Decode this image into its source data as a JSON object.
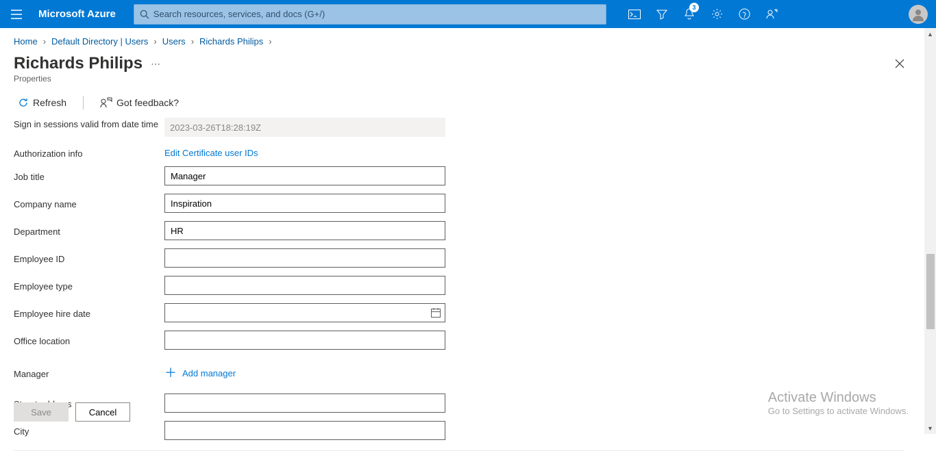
{
  "header": {
    "brand": "Microsoft Azure",
    "search_placeholder": "Search resources, services, and docs (G+/)",
    "notification_count": "3"
  },
  "breadcrumb": {
    "items": [
      "Home",
      "Default Directory | Users",
      "Users",
      "Richards Philips"
    ]
  },
  "page": {
    "title": "Richards Philips",
    "subtitle": "Properties"
  },
  "toolbar": {
    "refresh_label": "Refresh",
    "feedback_label": "Got feedback?"
  },
  "form": {
    "signin_label": "Sign in sessions valid from date time",
    "signin_value": "2023-03-26T18:28:19Z",
    "auth_info_label": "Authorization info",
    "auth_info_link": "Edit Certificate user IDs",
    "job_title_label": "Job title",
    "job_title_value": "Manager",
    "company_name_label": "Company name",
    "company_name_value": "Inspiration",
    "department_label": "Department",
    "department_value": "HR",
    "employee_id_label": "Employee ID",
    "employee_id_value": "",
    "employee_type_label": "Employee type",
    "employee_type_value": "",
    "employee_hire_date_label": "Employee hire date",
    "employee_hire_date_value": "",
    "office_location_label": "Office location",
    "office_location_value": "",
    "manager_label": "Manager",
    "add_manager_label": "Add manager",
    "street_address_label": "Street address",
    "street_address_value": "",
    "city_label": "City",
    "city_value": ""
  },
  "footer": {
    "save_label": "Save",
    "cancel_label": "Cancel"
  },
  "watermark": {
    "line1": "Activate Windows",
    "line2": "Go to Settings to activate Windows."
  }
}
